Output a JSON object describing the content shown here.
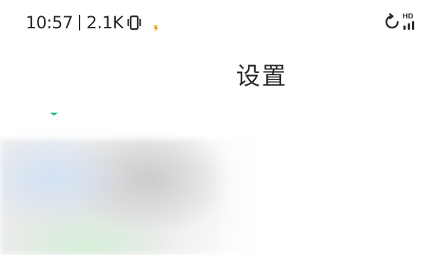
{
  "status_bar": {
    "time": "10:57",
    "net_speed": "2.1K",
    "icons": {
      "vibrate": "vibrate-icon",
      "notification": "notification-icon",
      "sync": "sync-icon",
      "signal": "signal-icon"
    },
    "network_label": "HD"
  },
  "header": {
    "title": "设置"
  },
  "colors": {
    "text": "#2b2b2b",
    "accent": "#1fb37a",
    "notification": "#e8b836"
  }
}
